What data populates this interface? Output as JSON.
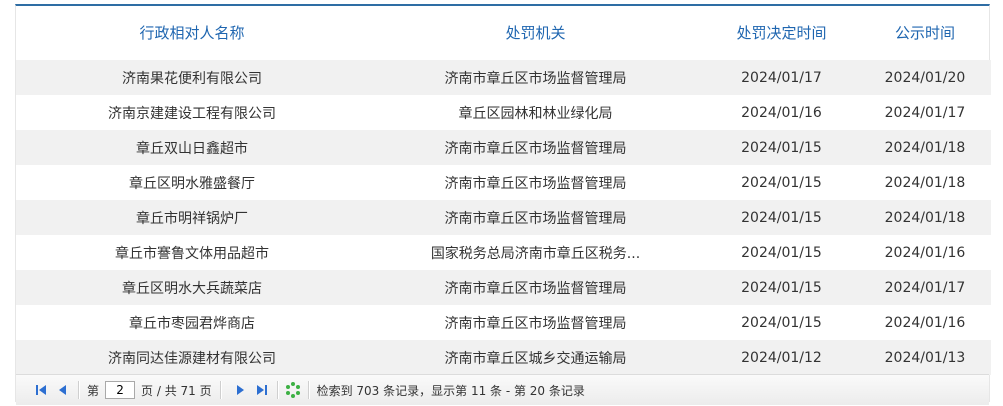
{
  "table": {
    "headers": [
      "行政相对人名称",
      "处罚机关",
      "处罚决定时间",
      "公示时间"
    ],
    "rows": [
      [
        "济南果花便利有限公司",
        "济南市章丘区市场监督管理局",
        "2024/01/17",
        "2024/01/20"
      ],
      [
        "济南京建建设工程有限公司",
        "章丘区园林和林业绿化局",
        "2024/01/16",
        "2024/01/17"
      ],
      [
        "章丘双山日鑫超市",
        "济南市章丘区市场监督管理局",
        "2024/01/15",
        "2024/01/18"
      ],
      [
        "章丘区明水雅盛餐厅",
        "济南市章丘区市场监督管理局",
        "2024/01/15",
        "2024/01/18"
      ],
      [
        "章丘市明祥锅炉厂",
        "济南市章丘区市场监督管理局",
        "2024/01/15",
        "2024/01/18"
      ],
      [
        "章丘市謇鲁文体用品超市",
        "国家税务总局济南市章丘区税务...",
        "2024/01/15",
        "2024/01/16"
      ],
      [
        "章丘区明水大兵蔬菜店",
        "济南市章丘区市场监督管理局",
        "2024/01/15",
        "2024/01/17"
      ],
      [
        "章丘市枣园君烨商店",
        "济南市章丘区市场监督管理局",
        "2024/01/15",
        "2024/01/16"
      ],
      [
        "济南同达佳源建材有限公司",
        "济南市章丘区城乡交通运输局",
        "2024/01/12",
        "2024/01/13"
      ]
    ]
  },
  "pager": {
    "page_prefix": "第",
    "page_value": "2",
    "page_suffix": "页 / 共 71 页",
    "summary": "检索到 703 条记录，显示第 11 条 - 第 20 条记录",
    "icons": [
      "first-page-icon",
      "prev-page-icon",
      "next-page-icon",
      "last-page-icon",
      "refresh-icon"
    ]
  },
  "colors": {
    "accent": "#2e6da4",
    "header_text": "#1f66b0",
    "row_alt": "#f1f1f1",
    "pager_icon": "#2d6fd1",
    "refresh": "#3cb043"
  }
}
